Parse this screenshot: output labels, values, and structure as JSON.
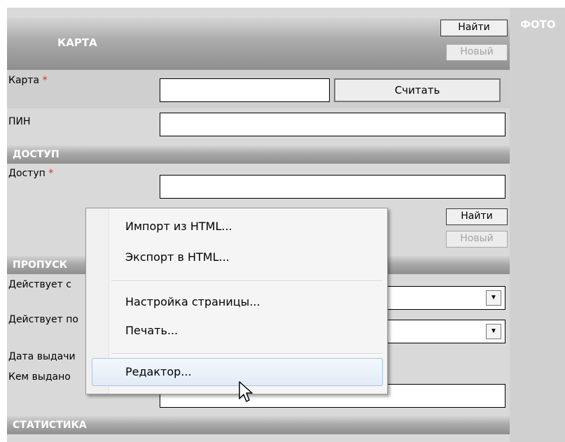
{
  "photo_panel": {
    "label": "ФОТО"
  },
  "card_section": {
    "title": "КАРТА",
    "find_button": "Найти",
    "new_button": "Новый",
    "card_label": "Карта",
    "required_mark": "*",
    "read_button": "Считать",
    "pin_label": "ПИН"
  },
  "access_section": {
    "title": "ДОСТУП",
    "access_label": "Доступ",
    "required_mark": "*",
    "find_button": "Найти",
    "new_button": "Новый"
  },
  "pass_section": {
    "title": "ПРОПУСК",
    "valid_from_label": "Действует с",
    "valid_to_label": "Действует по",
    "issue_date_label": "Дата выдачи",
    "issued_by_label": "Кем выдано"
  },
  "stats_section": {
    "title": "СТАТИСТИКА"
  },
  "context_menu": {
    "items": [
      "Импорт из HTML...",
      "Экспорт в HTML...",
      "Настройка страницы...",
      "Печать...",
      "Редактор..."
    ],
    "highlighted": "Редактор..."
  }
}
